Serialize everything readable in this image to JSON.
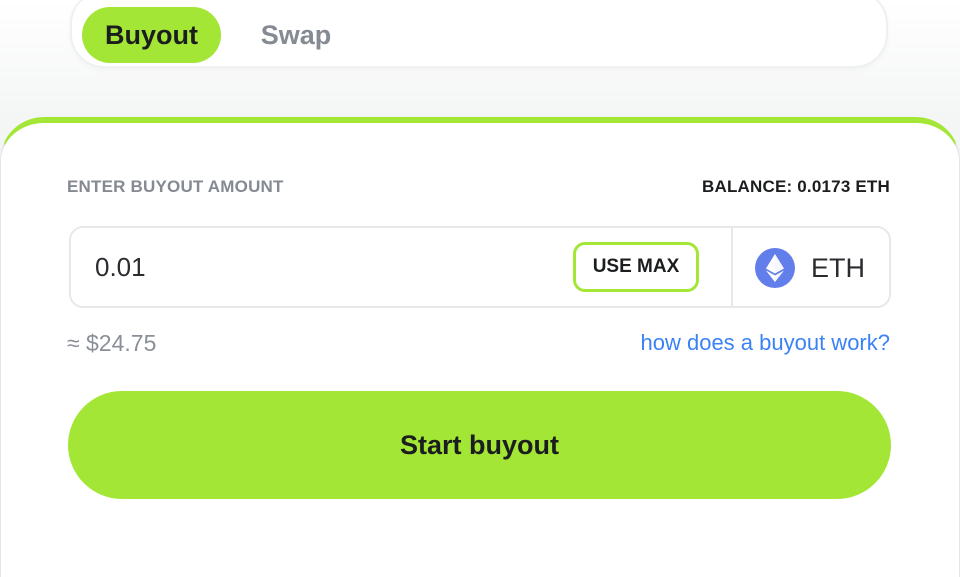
{
  "tabs": [
    {
      "label": "Buyout",
      "active": true
    },
    {
      "label": "Swap",
      "active": false
    }
  ],
  "form": {
    "section_label": "ENTER BUYOUT AMOUNT",
    "balance": "BALANCE: 0.0173 ETH",
    "amount_value": "0.01",
    "use_max_label": "USE MAX",
    "token_label": "ETH",
    "token_icon": "ethereum-icon",
    "usd_estimate": "≈ $24.75",
    "help_link": "how does a buyout work?",
    "submit_label": "Start buyout"
  },
  "colors": {
    "accent": "#a3e635",
    "link": "#3b82f6",
    "eth": "#627eea",
    "muted_text": "#848992"
  }
}
